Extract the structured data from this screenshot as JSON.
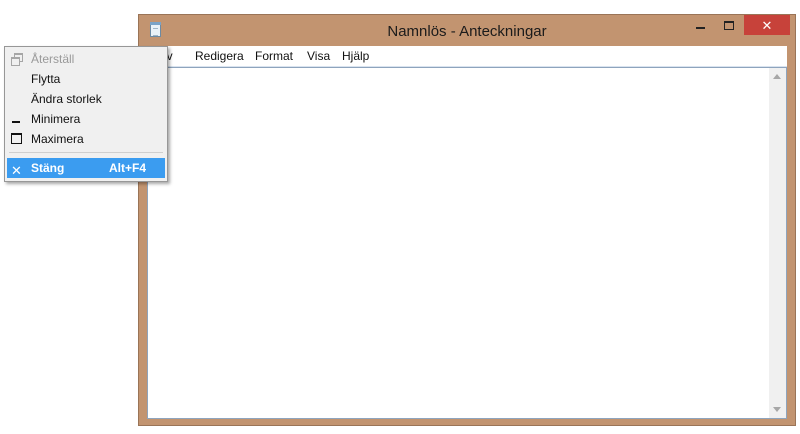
{
  "window": {
    "title": "Namnlös - Anteckningar",
    "controls": {
      "minimize_icon": "minimize-icon",
      "maximize_icon": "maximize-icon",
      "close_icon": "close-icon"
    }
  },
  "menubar": {
    "items": [
      "iv",
      "Redigera",
      "Format",
      "Visa",
      "Hjälp"
    ]
  },
  "system_menu": {
    "items": [
      {
        "label": "Återställ",
        "icon": "restore-icon",
        "enabled": false
      },
      {
        "label": "Flytta",
        "icon": "",
        "enabled": true
      },
      {
        "label": "Ändra storlek",
        "icon": "",
        "enabled": true
      },
      {
        "label": "Minimera",
        "icon": "minimize-icon",
        "enabled": true
      },
      {
        "label": "Maximera",
        "icon": "maximize-icon",
        "enabled": true
      },
      {
        "label": "Stäng",
        "accelerator": "Alt+F4",
        "icon": "close-icon",
        "enabled": true,
        "highlighted": true
      }
    ]
  },
  "colors": {
    "frame": "#c29470",
    "close_button": "#c7423a",
    "menu_highlight": "#3b9cf0"
  }
}
